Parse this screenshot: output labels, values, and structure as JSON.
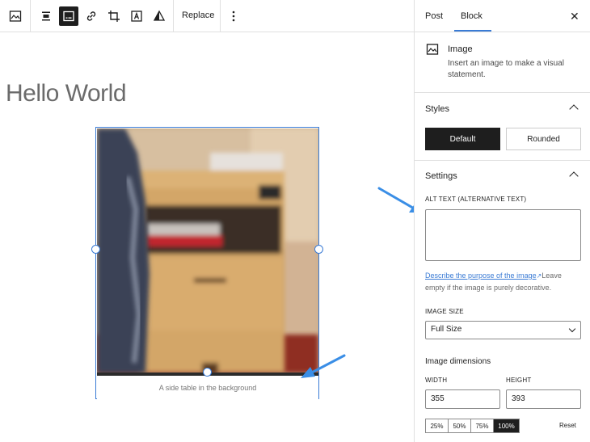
{
  "toolbar": {
    "replace_label": "Replace",
    "more_icon": "vertical-ellipsis-icon",
    "icons": [
      "image-icon",
      "align-icon",
      "caption-icon",
      "link-icon",
      "crop-icon",
      "text-overlay-icon",
      "duotone-icon"
    ]
  },
  "canvas": {
    "post_title": "Hello World",
    "caption": "A side table in the background"
  },
  "sidebar": {
    "tabs": [
      "Post",
      "Block"
    ],
    "active_tab": "Block",
    "close_icon": "close-icon",
    "block": {
      "name": "Image",
      "description": "Insert an image to make a visual statement."
    },
    "styles": {
      "title": "Styles",
      "options": [
        "Default",
        "Rounded"
      ],
      "selected": "Default"
    },
    "settings": {
      "title": "Settings",
      "alt_label": "ALT TEXT (ALTERNATIVE TEXT)",
      "alt_value": "",
      "help_link": "Describe the purpose of the image",
      "help_rest": "Leave empty if the image is purely decorative.",
      "size_label": "IMAGE SIZE",
      "size_value": "Full Size",
      "dimensions_title": "Image dimensions",
      "width_label": "WIDTH",
      "height_label": "HEIGHT",
      "width_value": "355",
      "height_value": "393",
      "percent_options": [
        "25%",
        "50%",
        "75%",
        "100%"
      ],
      "percent_selected": "100%",
      "reset_label": "Reset"
    }
  },
  "colors": {
    "accent": "#3a7bd5",
    "dark": "#1e1e1e",
    "arrow": "#3a8ee6"
  }
}
